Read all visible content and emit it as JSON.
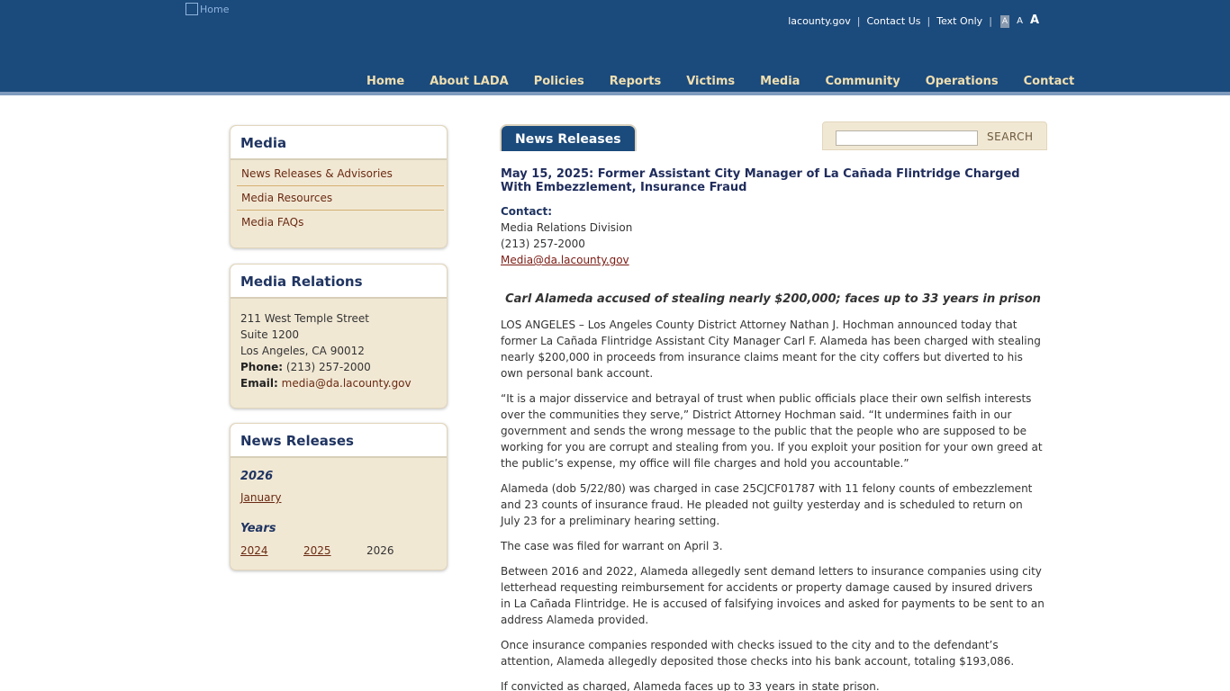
{
  "header": {
    "logo_alt": "Home",
    "utility": {
      "lacounty": "lacounty.gov",
      "contact": "Contact Us",
      "text_only": "Text Only",
      "size_small": "A",
      "size_medium": "A",
      "size_large": "A"
    },
    "nav": [
      "Home",
      "About LADA",
      "Policies",
      "Reports",
      "Victims",
      "Media",
      "Community",
      "Operations",
      "Contact"
    ]
  },
  "sidebar": {
    "media": {
      "title": "Media",
      "items": [
        "News Releases & Advisories",
        "Media Resources",
        "Media FAQs"
      ]
    },
    "relations": {
      "title": "Media Relations",
      "street": "211 West Temple Street",
      "suite": "Suite 1200",
      "city": "Los Angeles, CA 90012",
      "phone_label": "Phone:",
      "phone": "(213) 257-2000",
      "email_label": "Email:",
      "email": "media@da.lacounty.gov"
    },
    "releases": {
      "title": "News Releases",
      "year": "2026",
      "month_link": "January",
      "years_label": "Years",
      "years": [
        "2024",
        "2025",
        "2026"
      ]
    }
  },
  "main": {
    "tab": "News Releases",
    "search": {
      "placeholder": "",
      "button": "SEARCH"
    },
    "article": {
      "title": "May 15, 2025: Former Assistant City Manager of La Cañada Flintridge Charged With Embezzlement, Insurance Fraud",
      "contact_label": "Contact:",
      "contact_division": "Media Relations Division",
      "contact_phone": "(213) 257-2000",
      "contact_email": "Media@da.lacounty.gov",
      "subtitle": "Carl Alameda accused of stealing nearly $200,000; faces up to 33 years in prison",
      "paragraphs": [
        "LOS ANGELES – Los Angeles County District Attorney Nathan J. Hochman announced today that former La Cañada Flintridge Assistant City Manager Carl F. Alameda has been charged with stealing nearly $200,000 in proceeds from insurance claims meant for the city coffers but diverted to his own personal bank account.",
        "“It is a major disservice and betrayal of trust when public officials place their own selfish interests over the communities they serve,” District Attorney Hochman said. “It undermines faith in our government and sends the wrong message to the public that the people who are supposed to be working for you are corrupt and stealing from you. If you exploit your position for your own greed at the public’s expense, my office will file charges and hold you accountable.”",
        "Alameda (dob 5/22/80) was charged in case 25CJCF01787 with 11 felony counts of embezzlement and 23 counts of insurance fraud. He pleaded not guilty yesterday and is scheduled to return on July 23 for a preliminary hearing setting.",
        "The case was filed for warrant on April 3.",
        "Between 2016 and 2022, Alameda allegedly sent demand letters to insurance companies using city letterhead requesting reimbursement for accidents or property damage caused by insured drivers in La Cañada Flintridge. He is accused of falsifying invoices and asked for payments to be sent to an address Alameda provided.",
        "Once insurance companies responded with checks issued to the city and to the defendant’s attention, Alameda allegedly deposited those checks into his bank account, totaling $193,086.",
        "If convicted as charged, Alameda faces up to 33 years in state prison."
      ]
    }
  }
}
